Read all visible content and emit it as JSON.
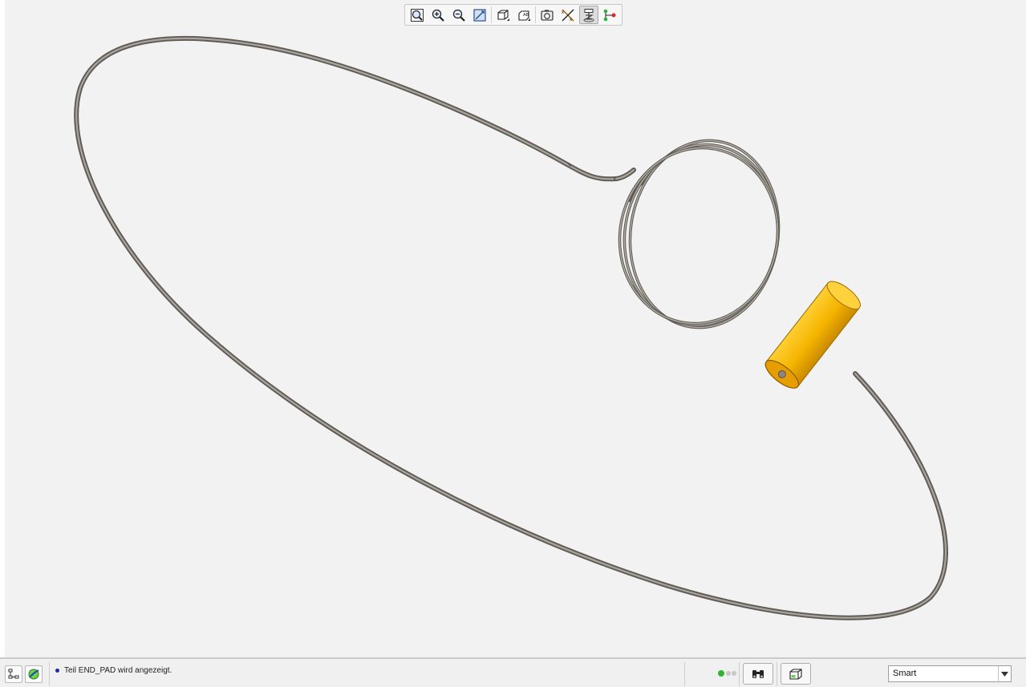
{
  "toolbar": {
    "items": [
      {
        "id": "refit",
        "icon": "zoom-fit-icon"
      },
      {
        "id": "zoom-in",
        "icon": "zoom-in-icon"
      },
      {
        "id": "zoom-out",
        "icon": "zoom-out-icon"
      },
      {
        "id": "repaint",
        "icon": "repaint-icon"
      },
      {
        "id": "display-style",
        "icon": "display-style-icon"
      },
      {
        "id": "saved-views",
        "icon": "saved-orientations-icon"
      },
      {
        "id": "view-manager",
        "icon": "view-manager-icon"
      },
      {
        "id": "datum-display",
        "icon": "datum-display-icon"
      },
      {
        "id": "spin-center",
        "icon": "spin-center-icon",
        "active": true
      },
      {
        "id": "annotation-display",
        "icon": "annotation-display-icon"
      }
    ],
    "separator_after": [
      "repaint",
      "saved-views"
    ]
  },
  "viewport": {
    "model_part_color": "#f5b800",
    "tube_color": "#8a857e",
    "background": "#f2f2f2"
  },
  "statusbar": {
    "message": "Teil END_PAD wird angezeigt.",
    "message_dot_color": "#1c2f9a",
    "left_icons": [
      "model-tree-icon",
      "browser-icon"
    ],
    "regen_status_color": "#33b233",
    "right_icons": [
      "find-icon",
      "selection-box-icon"
    ],
    "filter": {
      "value": "Smart"
    }
  }
}
